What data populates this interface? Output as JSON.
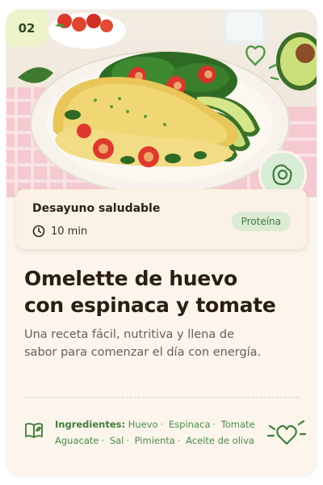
{
  "card": {
    "number": "02",
    "meal_type": "Desayuno saludable",
    "time": "10 min",
    "tag": "Proteína",
    "title_line1": "Omelette de huevo",
    "title_line2": "con espinaca y tomate",
    "description": "Una receta fácil, nutritiva y llena de sabor para comenzar el día con energía.",
    "ingredients_label": "Ingredientes:",
    "ingredients": [
      "Huevo",
      "Espinaca",
      "Tomate",
      "Aguacate",
      "Sal",
      "Pimienta",
      "Aceite de oliva"
    ]
  },
  "icons": {
    "time": "clock-icon",
    "badge": "fried-egg-icon",
    "ingredients": "recipe-book-icon",
    "decoration": "heart-doodle-icon"
  },
  "colors": {
    "card_background": "#fbf5ec",
    "accent_green": "#3f7d3a",
    "tag_background": "#dcebd3",
    "number_badge_background": "#eef3c9",
    "title_text": "#2b1d12"
  }
}
